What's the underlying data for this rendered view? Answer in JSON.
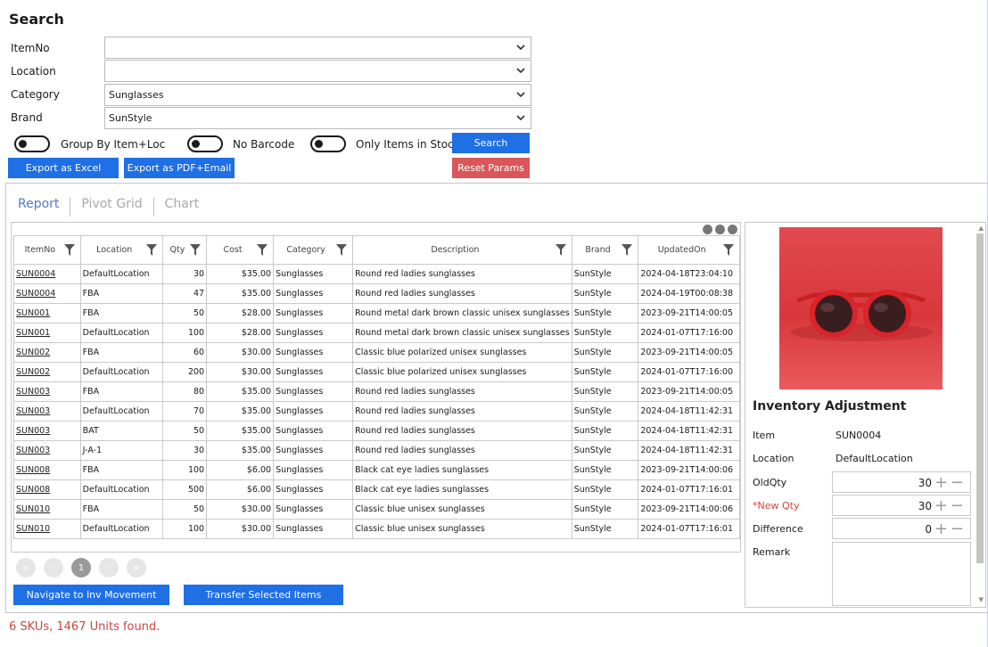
{
  "search": {
    "title": "Search",
    "fields": [
      {
        "label": "ItemNo",
        "value": ""
      },
      {
        "label": "Location",
        "value": ""
      },
      {
        "label": "Category",
        "value": "Sunglasses"
      },
      {
        "label": "Brand",
        "value": "SunStyle"
      }
    ],
    "toggles": [
      {
        "label": "Group By Item+Loc",
        "on": false
      },
      {
        "label": "No Barcode",
        "on": false
      },
      {
        "label": "Only Items in Stock",
        "on": false
      }
    ],
    "search_button": "Search",
    "reset_button": "Reset Params",
    "export_excel": "Export as Excel",
    "export_pdf": "Export as PDF+Email"
  },
  "tabs": [
    "Report",
    "Pivot Grid",
    "Chart"
  ],
  "table": {
    "columns": [
      "ItemNo",
      "Location",
      "Qty",
      "Cost",
      "Category",
      "Description",
      "Brand",
      "UpdatedOn"
    ],
    "rows": [
      [
        "SUN0004",
        "DefaultLocation",
        "30",
        "$35.00",
        "Sunglasses",
        "Round red ladies sunglasses",
        "SunStyle",
        "2024-04-18T23:04:10"
      ],
      [
        "SUN0004",
        "FBA",
        "47",
        "$35.00",
        "Sunglasses",
        "Round red ladies sunglasses",
        "SunStyle",
        "2024-04-19T00:08:38"
      ],
      [
        "SUN001",
        "FBA",
        "50",
        "$28.00",
        "Sunglasses",
        "Round metal dark brown classic unisex sunglasses",
        "SunStyle",
        "2023-09-21T14:00:05"
      ],
      [
        "SUN001",
        "DefaultLocation",
        "100",
        "$28.00",
        "Sunglasses",
        "Round metal dark brown classic unisex sunglasses",
        "SunStyle",
        "2024-01-07T17:16:00"
      ],
      [
        "SUN002",
        "FBA",
        "60",
        "$30.00",
        "Sunglasses",
        "Classic blue polarized unisex sunglasses",
        "SunStyle",
        "2023-09-21T14:00:05"
      ],
      [
        "SUN002",
        "DefaultLocation",
        "200",
        "$30.00",
        "Sunglasses",
        "Classic blue polarized unisex sunglasses",
        "SunStyle",
        "2024-01-07T17:16:00"
      ],
      [
        "SUN003",
        "FBA",
        "80",
        "$35.00",
        "Sunglasses",
        "Round red ladies sunglasses",
        "SunStyle",
        "2023-09-21T14:00:05"
      ],
      [
        "SUN003",
        "DefaultLocation",
        "70",
        "$35.00",
        "Sunglasses",
        "Round red ladies sunglasses",
        "SunStyle",
        "2024-04-18T11:42:31"
      ],
      [
        "SUN003",
        "BAT",
        "50",
        "$35.00",
        "Sunglasses",
        "Round red ladies sunglasses",
        "SunStyle",
        "2024-04-18T11:42:31"
      ],
      [
        "SUN003",
        "J-A-1",
        "30",
        "$35.00",
        "Sunglasses",
        "Round red ladies sunglasses",
        "SunStyle",
        "2024-04-18T11:42:31"
      ],
      [
        "SUN008",
        "FBA",
        "100",
        "$6.00",
        "Sunglasses",
        "Black cat eye ladies sunglasses",
        "SunStyle",
        "2023-09-21T14:00:06"
      ],
      [
        "SUN008",
        "DefaultLocation",
        "500",
        "$6.00",
        "Sunglasses",
        "Black cat eye ladies sunglasses",
        "SunStyle",
        "2024-01-07T17:16:01"
      ],
      [
        "SUN010",
        "FBA",
        "50",
        "$30.00",
        "Sunglasses",
        "Classic blue unisex sunglasses",
        "SunStyle",
        "2023-09-21T14:00:06"
      ],
      [
        "SUN010",
        "DefaultLocation",
        "100",
        "$30.00",
        "Sunglasses",
        "Classic blue unisex sunglasses",
        "SunStyle",
        "2024-01-07T17:16:01"
      ]
    ]
  },
  "pager": {
    "current": "1"
  },
  "actions": {
    "navigate": "Navigate to Inv Movement",
    "transfer": "Transfer Selected Items"
  },
  "status": "6 SKUs, 1467 Units found.",
  "adjustment": {
    "title": "Inventory Adjustment",
    "item_label": "Item",
    "item_value": "SUN0004",
    "location_label": "Location",
    "location_value": "DefaultLocation",
    "oldqty_label": "OldQty",
    "oldqty_value": "30",
    "newqty_label": "*New Qty",
    "newqty_value": "30",
    "difference_label": "Difference",
    "difference_value": "0",
    "remark_label": "Remark"
  },
  "colors": {
    "accent": "#1f6fe5",
    "danger": "#d9575b",
    "status": "#d0453f"
  }
}
